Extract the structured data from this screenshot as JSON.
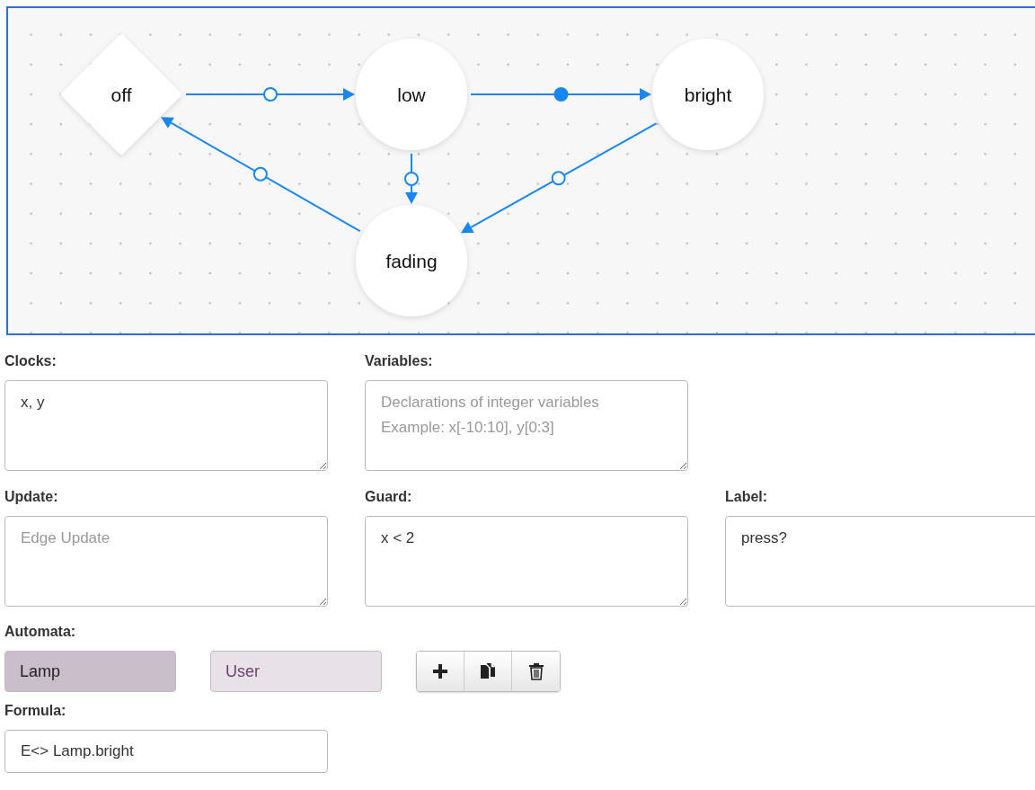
{
  "diagram": {
    "nodes": [
      {
        "label": "off",
        "kind": "diamond"
      },
      {
        "label": "low",
        "kind": "circle"
      },
      {
        "label": "bright",
        "kind": "circle"
      },
      {
        "label": "fading",
        "kind": "circle"
      }
    ],
    "edges": [
      {
        "filled": false
      },
      {
        "filled": true
      },
      {
        "filled": false
      },
      {
        "filled": false
      },
      {
        "filled": false
      }
    ]
  },
  "fields": [
    {
      "label": "Clocks:",
      "value": "x, y"
    },
    {
      "label": "Variables:",
      "placeholder": "Declarations of integer variables\nExample: x[-10:10], y[0:3]"
    },
    {
      "label": "Update:",
      "placeholder": "Edge Update"
    },
    {
      "label": "Guard:",
      "value": "x < 2"
    },
    {
      "label": "Label:",
      "value": "press?"
    }
  ],
  "automata": {
    "label": "Automata:",
    "items": [
      {
        "name": "Lamp",
        "selected": true
      },
      {
        "name": "User",
        "selected": false
      }
    ]
  },
  "formula": {
    "label": "Formula:",
    "value": "E<> Lamp.bright"
  }
}
